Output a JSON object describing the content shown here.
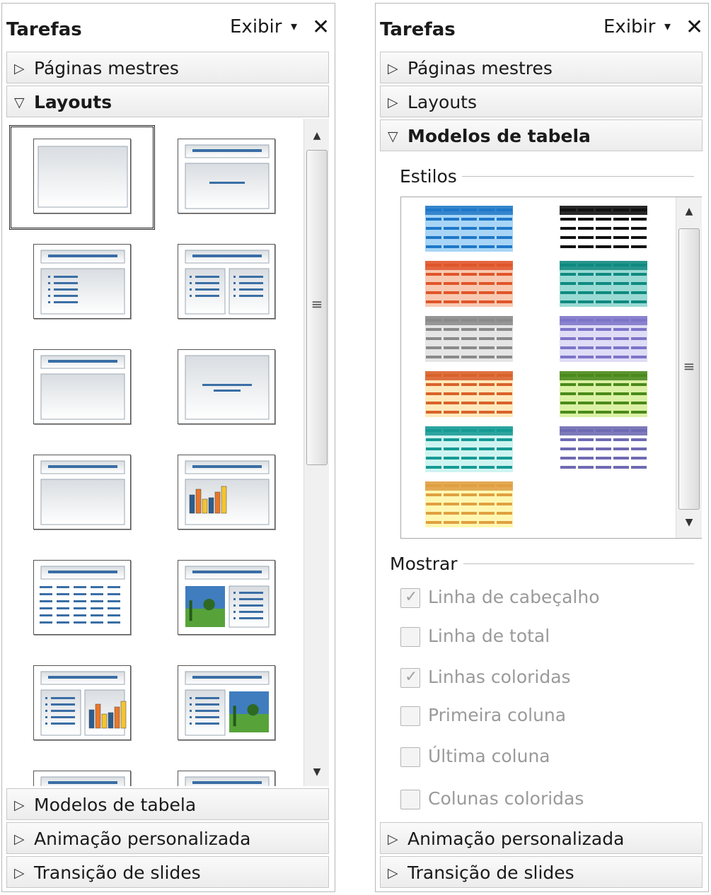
{
  "left_panel": {
    "title": "Tarefas",
    "view_label": "Exibir",
    "view_arrow": "▾",
    "close_glyph": "✕",
    "sections": [
      {
        "label": "Páginas mestres",
        "expanded": false
      },
      {
        "label": "Layouts",
        "expanded": true
      },
      {
        "label": "Modelos de tabela",
        "expanded": false
      },
      {
        "label": "Animação personalizada",
        "expanded": false
      },
      {
        "label": "Transição de slides",
        "expanded": false
      }
    ],
    "layouts": [
      "blank",
      "title-only-centered",
      "title-content",
      "title-two-content",
      "title-only",
      "centered-text",
      "title-content-blank",
      "title-chart",
      "title-table",
      "image-text",
      "text-chart",
      "text-image"
    ],
    "selected_layout": "blank"
  },
  "right_panel": {
    "title": "Tarefas",
    "view_label": "Exibir",
    "view_arrow": "▾",
    "close_glyph": "✕",
    "sections": [
      {
        "label": "Páginas mestres",
        "expanded": false
      },
      {
        "label": "Layouts",
        "expanded": false
      },
      {
        "label": "Modelos de tabela",
        "expanded": true
      },
      {
        "label": "Animação personalizada",
        "expanded": false
      },
      {
        "label": "Transição de slides",
        "expanded": false
      }
    ],
    "styles_label": "Estilos",
    "show_label": "Mostrar",
    "table_styles": [
      {
        "color": "#1f78c8",
        "light": "#9fd0f5"
      },
      {
        "color": "#111111",
        "light": "#ffffff"
      },
      {
        "color": "#e0552a",
        "light": "#f7c3a8"
      },
      {
        "color": "#0e8a80",
        "light": "#8fd6cf"
      },
      {
        "color": "#8a8a8a",
        "light": "#e2e2e2"
      },
      {
        "color": "#7d74c9",
        "light": "#dcd8f5"
      },
      {
        "color": "#d9622a",
        "light": "#ffe7b5"
      },
      {
        "color": "#4a8a1a",
        "light": "#d7ef9a"
      },
      {
        "color": "#159a94",
        "light": "#c9f3ef"
      },
      {
        "color": "#6f6ab3",
        "light": "#ffffff"
      },
      {
        "color": "#e0a040",
        "light": "#fff6a8"
      }
    ],
    "options": [
      {
        "label": "Linha de cabeçalho",
        "checked": true
      },
      {
        "label": "Linha de total",
        "checked": false
      },
      {
        "label": "Linhas coloridas",
        "checked": true
      },
      {
        "label": "Primeira coluna",
        "checked": false
      },
      {
        "label": "Última coluna",
        "checked": false
      },
      {
        "label": "Colunas coloridas",
        "checked": false
      }
    ],
    "check_glyph": "✓"
  },
  "icons": {
    "collapsed_triangle": "▷",
    "expanded_triangle": "▽",
    "scroll_up": "▲",
    "scroll_down": "▼",
    "scroll_grip": "≡"
  }
}
